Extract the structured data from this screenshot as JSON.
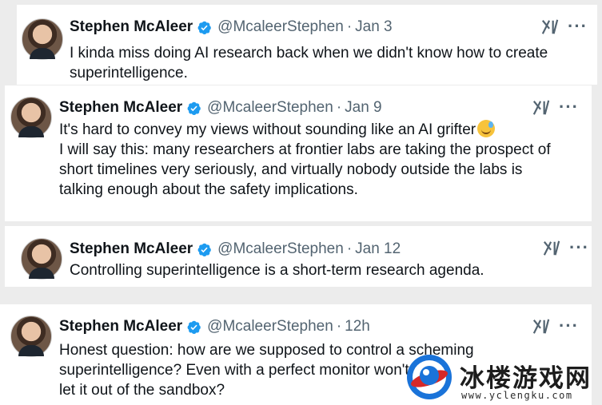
{
  "tweets": [
    {
      "name": "Stephen McAleer",
      "handle": "@McaleerStephen",
      "separator": "·",
      "time": "Jan 3",
      "text": "I kinda miss doing AI research back when we didn't know how to create\nsuperintelligence.",
      "verified_icon": "verified-badge-icon",
      "brand_icon": "xai-icon",
      "more_label": "···"
    },
    {
      "name": "Stephen McAleer",
      "handle": "@McaleerStephen",
      "separator": "·",
      "time": "Jan 9",
      "text_line1": "It's hard to convey my views without sounding like an AI grifter",
      "emoji_icon": "sweat-smile-emoji",
      "text_rest": "\nI will say this: many researchers at frontier labs are taking the prospect of\nshort timelines very seriously, and virtually nobody outside the labs is\ntalking enough about the safety implications.",
      "verified_icon": "verified-badge-icon",
      "brand_icon": "xai-icon",
      "more_label": "···"
    },
    {
      "name": "Stephen McAleer",
      "handle": "@McaleerStephen",
      "separator": "·",
      "time": "Jan 12",
      "text": "Controlling superintelligence is a short-term research agenda.",
      "verified_icon": "verified-badge-icon",
      "brand_icon": "xai-icon",
      "more_label": "···"
    },
    {
      "name": "Stephen McAleer",
      "handle": "@McaleerStephen",
      "separator": "·",
      "time": "12h",
      "text": "Honest question: how are we supposed to control a scheming\nsuperintelligence? Even with a perfect monitor won't\nlet it out of the sandbox?",
      "verified_icon": "verified-badge-icon",
      "brand_icon": "xai-icon",
      "more_label": "···"
    }
  ],
  "watermark": {
    "title": "冰楼游戏网",
    "url": "www.yclengku.com"
  },
  "colors": {
    "verified": "#1d9bf0",
    "secondary_text": "#536471",
    "primary_text": "#0f1419"
  }
}
